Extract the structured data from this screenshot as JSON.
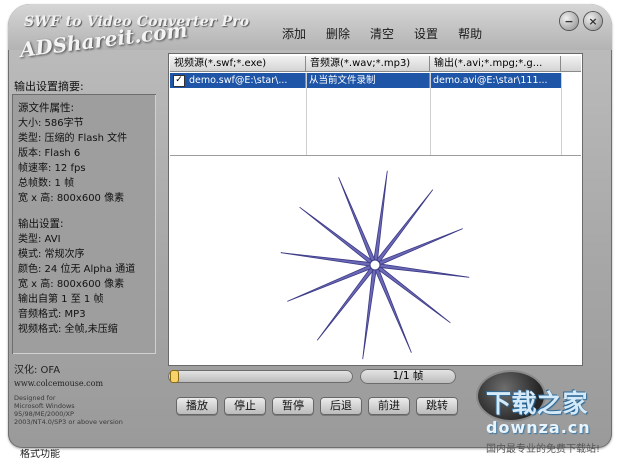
{
  "app": {
    "title": "SWF to Video Converter Pro",
    "logo": "ADShareit.com",
    "minimize_glyph": "−",
    "close_glyph": "×"
  },
  "menu": [
    "添加",
    "删除",
    "清空",
    "设置",
    "帮助"
  ],
  "left": {
    "header": "输出设置摘要:",
    "source_title": "源文件属性:",
    "source_lines": [
      "大小: 586字节",
      "类型: 压缩的 Flash 文件",
      "版本: Flash 6",
      "帧速率: 12 fps",
      "总帧数: 1 帧",
      "宽 x 高: 800x600 像素"
    ],
    "output_title": "输出设置:",
    "output_lines": [
      "类型: AVI",
      "模式: 常规次序",
      "颜色: 24 位无 Alpha 通道",
      "宽 x 高: 800x600 像素",
      "输出自第 1 至 1 帧",
      "音频格式: MP3",
      "视频格式: 全帧,未压缩"
    ]
  },
  "credits": {
    "localized": "汉化: OFA",
    "site": "www.colcemouse.com",
    "small": [
      "Designed for",
      "Microsoft Windows",
      "95/98/ME/2000/XP",
      "2003/NT4.0/SP3 or above version"
    ]
  },
  "table": {
    "headers": [
      "视频源(*.swf;*.exe)",
      "音频源(*.wav;*.mp3)",
      "输出(*.avi;*.mpg;*.g..."
    ],
    "rows": [
      {
        "checked": true,
        "video": "demo.swf@E:\\star\\...",
        "audio": "从当前文件录制",
        "output": "demo.avi@E:\\star\\111..."
      }
    ]
  },
  "preview": {
    "shape": "star",
    "points": 12,
    "fill": "#6b68b6",
    "stroke": "#3c3a86"
  },
  "playback": {
    "progress": 0,
    "frame_counter": "1/1 帧",
    "buttons": [
      "播放",
      "停止",
      "暂停",
      "后退",
      "前进",
      "跳转"
    ]
  },
  "watermark": {
    "main": "下载之家",
    "url": "downza.cn",
    "tag": "国内最专业的免费下载站!"
  },
  "bottom_caption": "格式功能"
}
